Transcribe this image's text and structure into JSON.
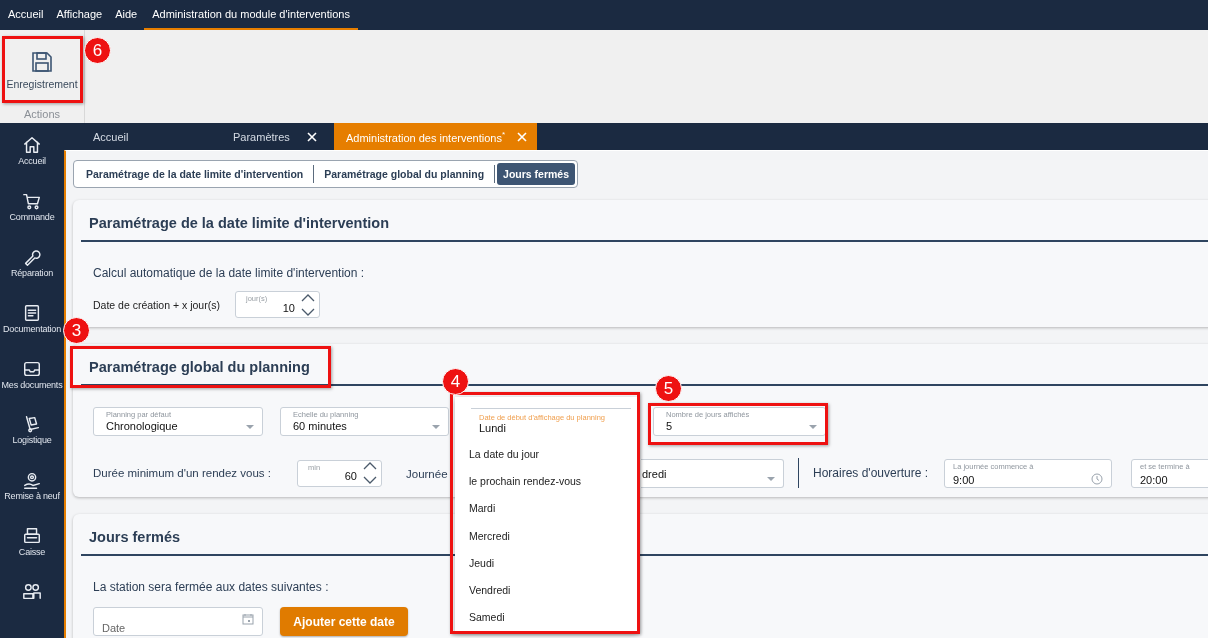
{
  "menu_bar": [
    {
      "label": "Accueil",
      "selected": false
    },
    {
      "label": "Affichage",
      "selected": false
    },
    {
      "label": "Aide",
      "selected": false
    },
    {
      "label": "Administration du module d'interventions",
      "selected": true
    }
  ],
  "ribbon": {
    "button": {
      "label": "Enregistrement"
    },
    "group_label": "Actions"
  },
  "sidebar": [
    {
      "label": "Accueil"
    },
    {
      "label": "Commande"
    },
    {
      "label": "Réparation"
    },
    {
      "label": "Documentation"
    },
    {
      "label": "Mes documents"
    },
    {
      "label": "Logistique"
    },
    {
      "label": "Remise à neuf"
    },
    {
      "label": "Caisse"
    }
  ],
  "doc_tabs": [
    {
      "label": "Accueil",
      "selected": false,
      "closable": false
    },
    {
      "label": "Paramètres",
      "selected": false,
      "closable": true
    },
    {
      "label": "Administration des interventions$^{*}$",
      "selected": true,
      "closable": true
    }
  ],
  "section_tabs": [
    {
      "label": "Paramétrage de la date limite d'intervention",
      "selected": false
    },
    {
      "label": "Paramétrage global du planning",
      "selected": false
    },
    {
      "label": "Jours fermés",
      "selected": true
    }
  ],
  "deadline_section": {
    "title": "Paramétrage de la date limite d'intervention",
    "description": "Calcul automatique de la date limite d'intervention :",
    "field_label": "Date de création + x jour(s)",
    "days": {
      "label": "jour(s)",
      "value": "10"
    }
  },
  "planning_section": {
    "title": "Paramétrage global du planning",
    "selects": [
      {
        "label": "Planning par défaut",
        "value": "Chronologique"
      },
      {
        "label": "Echelle du planning",
        "value": "60 minutes"
      }
    ],
    "start_dropdown": {
      "label": "Date de début d'affichage du planning",
      "value": "Lundi",
      "options": [
        "La date du jour",
        "le prochain rendez-vous",
        "Mardi",
        "Mercredi",
        "Jeudi",
        "Vendredi",
        "Samedi"
      ]
    },
    "days_shown": {
      "label": "Nombre de jours affichés",
      "value": "5"
    },
    "min_duration": {
      "label": "Durée minimum d'un rendez vous :",
      "unit": "min",
      "value": "60"
    },
    "day_label": "Journée",
    "day_select_value": "dredi",
    "hours": {
      "label": "Horaires d'ouverture :",
      "start": {
        "label": "La journée commence à",
        "value": "9:00"
      },
      "end": {
        "label": "et se termine à",
        "value": "20:00"
      }
    }
  },
  "closed_section": {
    "title": "Jours fermés",
    "description": "La station sera fermée aux dates suivantes :",
    "date_field": {
      "placeholder": "Date"
    },
    "add_button": "Ajouter cette date"
  },
  "callouts": [
    {
      "number": "6"
    },
    {
      "number": "3"
    },
    {
      "number": "4"
    },
    {
      "number": "5"
    }
  ]
}
